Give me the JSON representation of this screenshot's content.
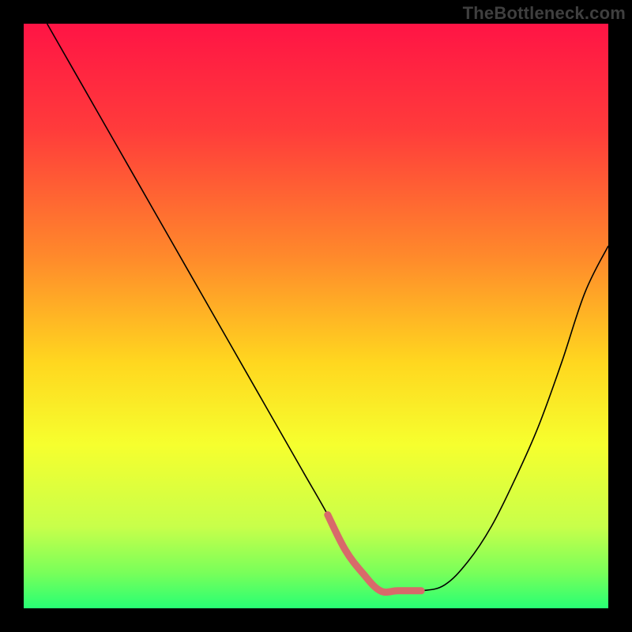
{
  "watermark": "TheBottleneck.com",
  "chart_data": {
    "type": "line",
    "title": "",
    "xlabel": "",
    "ylabel": "",
    "xlim": [
      0,
      100
    ],
    "ylim": [
      0,
      100
    ],
    "gradient_stops": [
      {
        "offset": 0,
        "color": "#ff1445"
      },
      {
        "offset": 18,
        "color": "#ff3b3b"
      },
      {
        "offset": 40,
        "color": "#ff8a2b"
      },
      {
        "offset": 58,
        "color": "#ffd71f"
      },
      {
        "offset": 72,
        "color": "#f6ff2e"
      },
      {
        "offset": 86,
        "color": "#c8ff4a"
      },
      {
        "offset": 94,
        "color": "#78ff5a"
      },
      {
        "offset": 100,
        "color": "#27ff74"
      }
    ],
    "series": [
      {
        "name": "bottleneck-curve",
        "type": "line",
        "stroke": "#000000",
        "stroke_width": 1.6,
        "x": [
          4,
          8,
          12,
          16,
          20,
          24,
          28,
          32,
          36,
          40,
          44,
          48,
          52,
          55,
          58,
          61,
          64,
          68,
          72,
          76,
          80,
          84,
          88,
          92,
          96,
          100
        ],
        "values": [
          100,
          93,
          86,
          79,
          72,
          65,
          58,
          51,
          44,
          37,
          30,
          23,
          16,
          10,
          6,
          3,
          3,
          3,
          4,
          8,
          14,
          22,
          31,
          42,
          54,
          62
        ]
      },
      {
        "name": "optimal-zone",
        "type": "line",
        "stroke": "#d86a6a",
        "stroke_width": 9,
        "linecap": "round",
        "x": [
          52,
          55,
          58,
          61,
          64,
          68
        ],
        "values": [
          16,
          10,
          6,
          3,
          3,
          3
        ]
      }
    ]
  }
}
